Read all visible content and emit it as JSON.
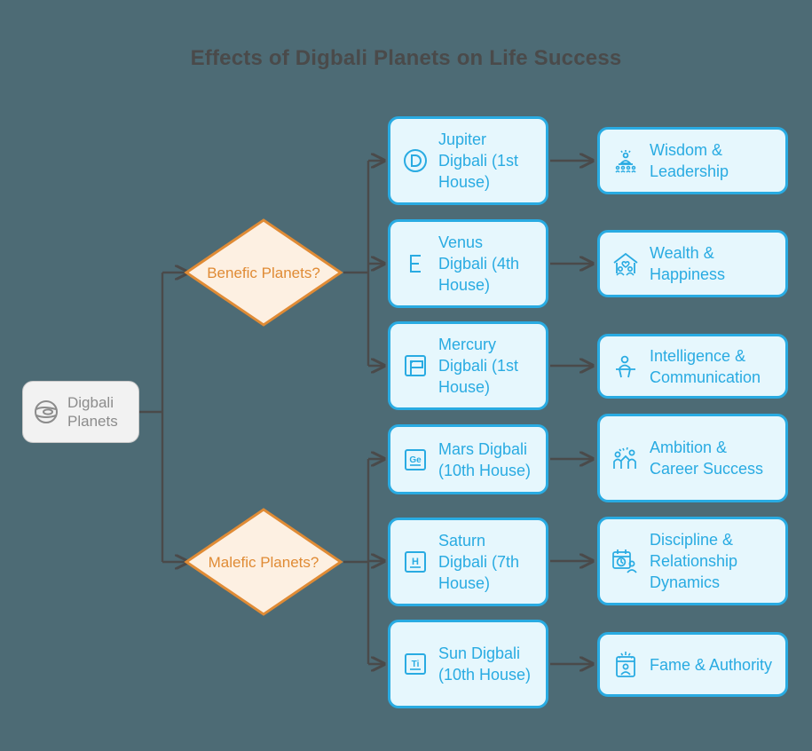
{
  "title": "Effects of Digbali Planets on Life Success",
  "theme": {
    "background": "#4d6b75",
    "title_color": "#4a4a4a",
    "connector_color": "#4a4a4a",
    "decision_border": "#e08b35",
    "decision_fill": "#fdf0e2",
    "decision_text": "#e08b35",
    "box_border": "#29abe2",
    "box_fill": "#e6f7fd",
    "box_text": "#29abe2",
    "root_fill": "#f2f2f2",
    "root_border": "#c9c9c9",
    "root_text": "#8c8c8c"
  },
  "root": {
    "label": "Digbali Planets",
    "icon": "planet-icon"
  },
  "decisions": [
    {
      "label": "Benefic Planets?",
      "name": "decision-benefic-planets"
    },
    {
      "label": "Malefic Planets?",
      "name": "decision-malefic-planets"
    }
  ],
  "planets": [
    {
      "label": "Jupiter Digbali (1st House)",
      "icon": "circled-d-icon",
      "glyph": "D"
    },
    {
      "label": "Venus Digbali (4th House)",
      "icon": "letter-e-icon",
      "glyph": "E"
    },
    {
      "label": "Mercury Digbali (1st House)",
      "icon": "flag-chart-icon",
      "glyph": ""
    },
    {
      "label": "Mars Digbali (10th House)",
      "icon": "element-ge-icon",
      "glyph": "Ge"
    },
    {
      "label": "Saturn Digbali (7th House)",
      "icon": "element-h-icon",
      "glyph": "H"
    },
    {
      "label": "Sun Digbali (10th House)",
      "icon": "element-ti-icon",
      "glyph": "Ti"
    }
  ],
  "outcomes": [
    {
      "label": "Wisdom & Leadership",
      "icon": "podium-audience-icon"
    },
    {
      "label": "Wealth & Happiness",
      "icon": "family-home-heart-icon"
    },
    {
      "label": "Intelligence & Communication",
      "icon": "speaker-podium-icon"
    },
    {
      "label": "Ambition & Career Success",
      "icon": "high-five-celebration-icon"
    },
    {
      "label": "Discipline & Relationship Dynamics",
      "icon": "calendar-clock-person-icon"
    },
    {
      "label": "Fame & Authority",
      "icon": "award-badge-icon"
    }
  ]
}
